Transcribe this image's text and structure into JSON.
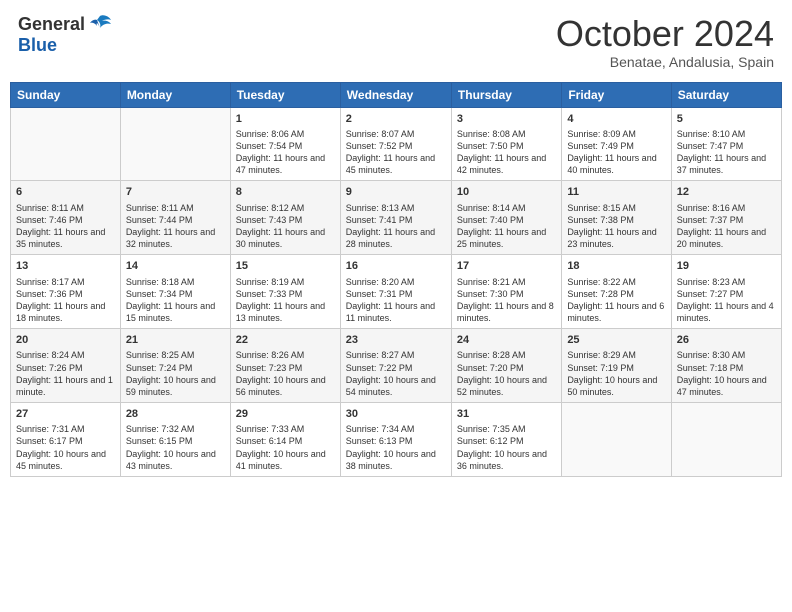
{
  "header": {
    "logo_line1": "General",
    "logo_line2": "Blue",
    "month_title": "October 2024",
    "subtitle": "Benatae, Andalusia, Spain"
  },
  "weekdays": [
    "Sunday",
    "Monday",
    "Tuesday",
    "Wednesday",
    "Thursday",
    "Friday",
    "Saturday"
  ],
  "weeks": [
    [
      {
        "day": "",
        "info": ""
      },
      {
        "day": "",
        "info": ""
      },
      {
        "day": "1",
        "info": "Sunrise: 8:06 AM\nSunset: 7:54 PM\nDaylight: 11 hours and 47 minutes."
      },
      {
        "day": "2",
        "info": "Sunrise: 8:07 AM\nSunset: 7:52 PM\nDaylight: 11 hours and 45 minutes."
      },
      {
        "day": "3",
        "info": "Sunrise: 8:08 AM\nSunset: 7:50 PM\nDaylight: 11 hours and 42 minutes."
      },
      {
        "day": "4",
        "info": "Sunrise: 8:09 AM\nSunset: 7:49 PM\nDaylight: 11 hours and 40 minutes."
      },
      {
        "day": "5",
        "info": "Sunrise: 8:10 AM\nSunset: 7:47 PM\nDaylight: 11 hours and 37 minutes."
      }
    ],
    [
      {
        "day": "6",
        "info": "Sunrise: 8:11 AM\nSunset: 7:46 PM\nDaylight: 11 hours and 35 minutes."
      },
      {
        "day": "7",
        "info": "Sunrise: 8:11 AM\nSunset: 7:44 PM\nDaylight: 11 hours and 32 minutes."
      },
      {
        "day": "8",
        "info": "Sunrise: 8:12 AM\nSunset: 7:43 PM\nDaylight: 11 hours and 30 minutes."
      },
      {
        "day": "9",
        "info": "Sunrise: 8:13 AM\nSunset: 7:41 PM\nDaylight: 11 hours and 28 minutes."
      },
      {
        "day": "10",
        "info": "Sunrise: 8:14 AM\nSunset: 7:40 PM\nDaylight: 11 hours and 25 minutes."
      },
      {
        "day": "11",
        "info": "Sunrise: 8:15 AM\nSunset: 7:38 PM\nDaylight: 11 hours and 23 minutes."
      },
      {
        "day": "12",
        "info": "Sunrise: 8:16 AM\nSunset: 7:37 PM\nDaylight: 11 hours and 20 minutes."
      }
    ],
    [
      {
        "day": "13",
        "info": "Sunrise: 8:17 AM\nSunset: 7:36 PM\nDaylight: 11 hours and 18 minutes."
      },
      {
        "day": "14",
        "info": "Sunrise: 8:18 AM\nSunset: 7:34 PM\nDaylight: 11 hours and 15 minutes."
      },
      {
        "day": "15",
        "info": "Sunrise: 8:19 AM\nSunset: 7:33 PM\nDaylight: 11 hours and 13 minutes."
      },
      {
        "day": "16",
        "info": "Sunrise: 8:20 AM\nSunset: 7:31 PM\nDaylight: 11 hours and 11 minutes."
      },
      {
        "day": "17",
        "info": "Sunrise: 8:21 AM\nSunset: 7:30 PM\nDaylight: 11 hours and 8 minutes."
      },
      {
        "day": "18",
        "info": "Sunrise: 8:22 AM\nSunset: 7:28 PM\nDaylight: 11 hours and 6 minutes."
      },
      {
        "day": "19",
        "info": "Sunrise: 8:23 AM\nSunset: 7:27 PM\nDaylight: 11 hours and 4 minutes."
      }
    ],
    [
      {
        "day": "20",
        "info": "Sunrise: 8:24 AM\nSunset: 7:26 PM\nDaylight: 11 hours and 1 minute."
      },
      {
        "day": "21",
        "info": "Sunrise: 8:25 AM\nSunset: 7:24 PM\nDaylight: 10 hours and 59 minutes."
      },
      {
        "day": "22",
        "info": "Sunrise: 8:26 AM\nSunset: 7:23 PM\nDaylight: 10 hours and 56 minutes."
      },
      {
        "day": "23",
        "info": "Sunrise: 8:27 AM\nSunset: 7:22 PM\nDaylight: 10 hours and 54 minutes."
      },
      {
        "day": "24",
        "info": "Sunrise: 8:28 AM\nSunset: 7:20 PM\nDaylight: 10 hours and 52 minutes."
      },
      {
        "day": "25",
        "info": "Sunrise: 8:29 AM\nSunset: 7:19 PM\nDaylight: 10 hours and 50 minutes."
      },
      {
        "day": "26",
        "info": "Sunrise: 8:30 AM\nSunset: 7:18 PM\nDaylight: 10 hours and 47 minutes."
      }
    ],
    [
      {
        "day": "27",
        "info": "Sunrise: 7:31 AM\nSunset: 6:17 PM\nDaylight: 10 hours and 45 minutes."
      },
      {
        "day": "28",
        "info": "Sunrise: 7:32 AM\nSunset: 6:15 PM\nDaylight: 10 hours and 43 minutes."
      },
      {
        "day": "29",
        "info": "Sunrise: 7:33 AM\nSunset: 6:14 PM\nDaylight: 10 hours and 41 minutes."
      },
      {
        "day": "30",
        "info": "Sunrise: 7:34 AM\nSunset: 6:13 PM\nDaylight: 10 hours and 38 minutes."
      },
      {
        "day": "31",
        "info": "Sunrise: 7:35 AM\nSunset: 6:12 PM\nDaylight: 10 hours and 36 minutes."
      },
      {
        "day": "",
        "info": ""
      },
      {
        "day": "",
        "info": ""
      }
    ]
  ]
}
